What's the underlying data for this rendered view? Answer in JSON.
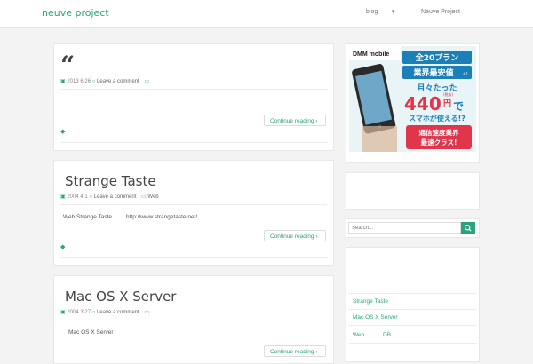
{
  "header": {
    "brand": "neuve project",
    "nav": {
      "blog": "blog",
      "caret": "▾",
      "project": "Neuve Project"
    }
  },
  "posts": [
    {
      "title": "",
      "date": "2013 6 26",
      "comments": "Leave a comment",
      "category": "",
      "body": "",
      "continue": "Continue reading"
    },
    {
      "title": "Strange Taste",
      "date": "2004 4 1",
      "comments": "Leave a comment",
      "category": "Web",
      "body_a": "Web Strange Taste",
      "body_b": "http://www.strangetaste.net/",
      "continue": "Continue reading"
    },
    {
      "title": "Mac OS X Server",
      "date": "2004 3 27",
      "comments": "Leave a comment",
      "category": "",
      "body": "Mac OS X Server",
      "continue": "Continue reading"
    }
  ],
  "sidebar": {
    "banner": {
      "brand": "DMM mobile",
      "line1": "全20プラン",
      "line2": "業界最安値",
      "line2_note": "※1",
      "line3": "月々たった",
      "price": "440",
      "price_unit": "円",
      "price_tax": "(税抜)",
      "price_suffix": "で",
      "line4": "スマホが使える!?",
      "line5": "通信速度業界",
      "line6": "最速クラス!"
    },
    "search_placeholder": "Search...",
    "recent": [
      "Strange Taste",
      "Mac OS X Server",
      "Web"
    ],
    "recent_extra": "DB"
  },
  "colors": {
    "accent": "#2ca37a",
    "banner_blue": "#1b7fb8",
    "banner_red": "#e0354b"
  }
}
